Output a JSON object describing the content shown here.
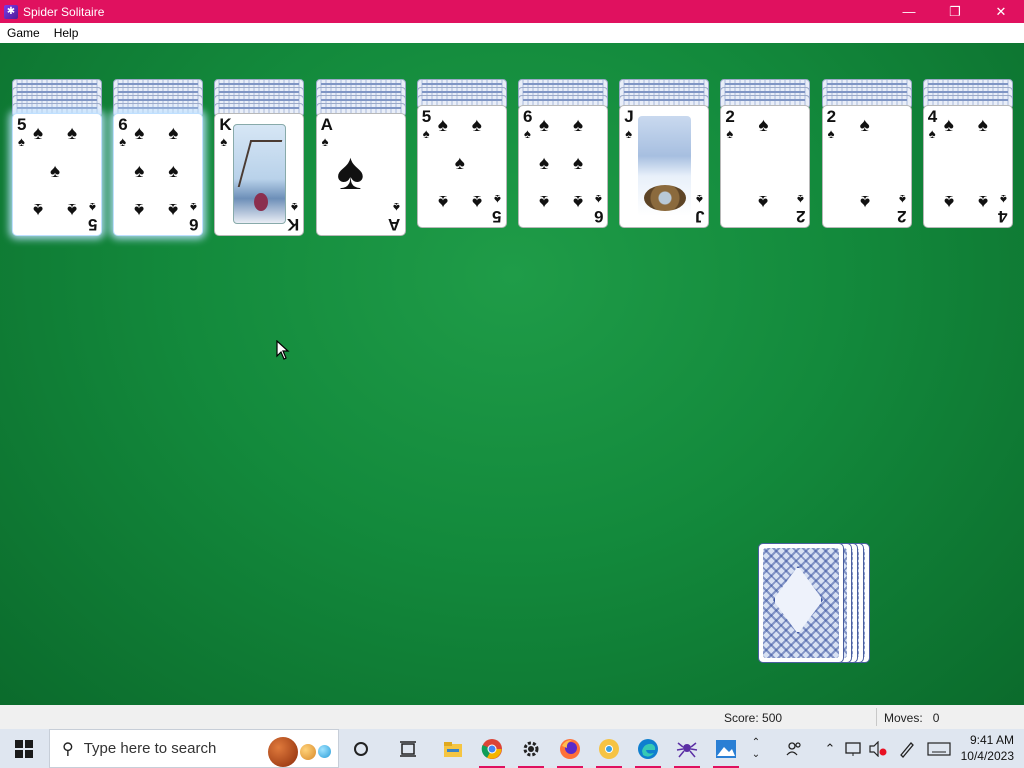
{
  "window": {
    "title": "Spider Solitaire",
    "controls": [
      "minimize",
      "restore",
      "close"
    ]
  },
  "menu": {
    "items": [
      "Game",
      "Help"
    ]
  },
  "tableau": [
    {
      "face_down": 4,
      "top": {
        "rank": "5",
        "suit": "spade",
        "selected": true
      }
    },
    {
      "face_down": 4,
      "top": {
        "rank": "6",
        "suit": "spade",
        "selected": true
      }
    },
    {
      "face_down": 4,
      "top": {
        "rank": "K",
        "suit": "spade",
        "selected": false
      }
    },
    {
      "face_down": 4,
      "top": {
        "rank": "A",
        "suit": "spade",
        "selected": false
      }
    },
    {
      "face_down": 3,
      "top": {
        "rank": "5",
        "suit": "spade",
        "selected": false
      }
    },
    {
      "face_down": 3,
      "top": {
        "rank": "6",
        "suit": "spade",
        "selected": false
      }
    },
    {
      "face_down": 3,
      "top": {
        "rank": "J",
        "suit": "spade",
        "selected": false
      }
    },
    {
      "face_down": 3,
      "top": {
        "rank": "2",
        "suit": "spade",
        "selected": false
      }
    },
    {
      "face_down": 3,
      "top": {
        "rank": "2",
        "suit": "spade",
        "selected": false
      }
    },
    {
      "face_down": 3,
      "top": {
        "rank": "4",
        "suit": "spade",
        "selected": false
      }
    }
  ],
  "stock": {
    "piles": 5
  },
  "status": {
    "score_label": "Score: 500",
    "moves_label": "Moves:",
    "moves_value": "0"
  },
  "taskbar": {
    "search_placeholder": "Type here to search",
    "time": "9:41 AM",
    "date": "10/4/2023",
    "apps": [
      "cortana-icon",
      "task-view-icon",
      "file-explorer-icon",
      "chrome-icon",
      "settings-icon",
      "firefox-icon",
      "chrome-canary-icon",
      "edge-icon",
      "spider-solitaire-icon",
      "photos-icon"
    ]
  },
  "colors": {
    "title_bar": "#e0115f",
    "felt": "#138a3c",
    "card_back": "#3c54a0"
  }
}
